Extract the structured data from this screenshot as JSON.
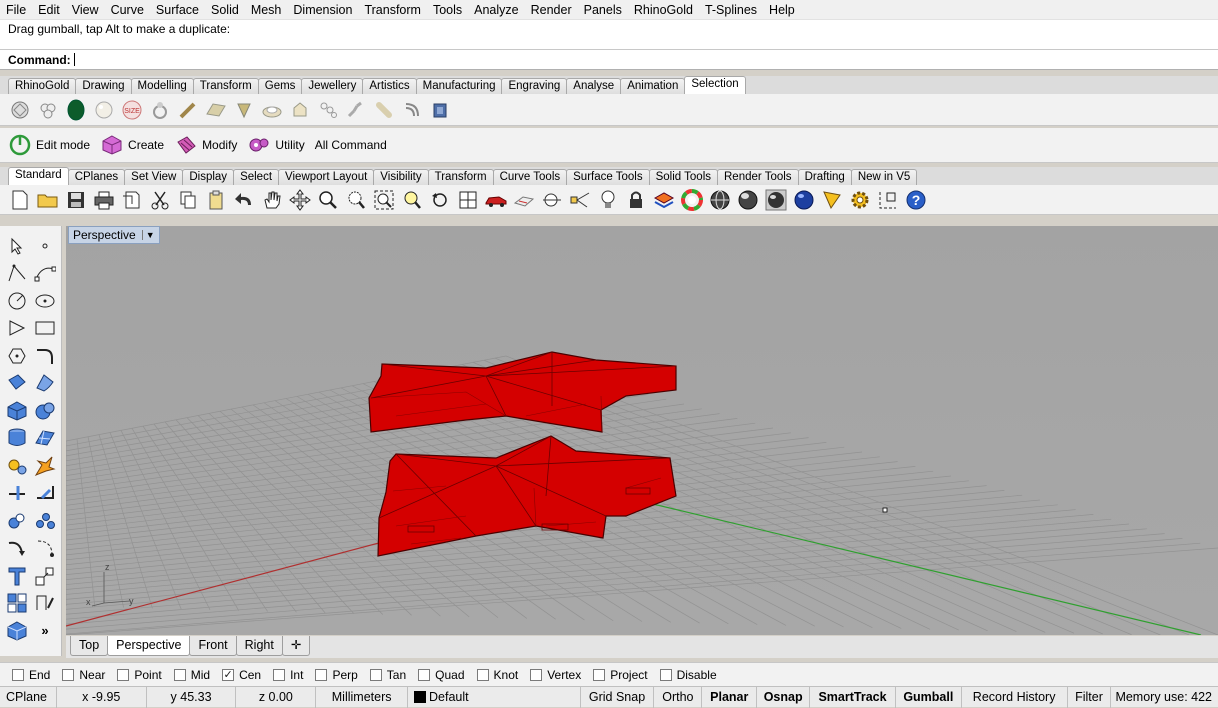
{
  "menu": [
    "File",
    "Edit",
    "View",
    "Curve",
    "Surface",
    "Solid",
    "Mesh",
    "Dimension",
    "Transform",
    "Tools",
    "Analyze",
    "Render",
    "Panels",
    "RhinoGold",
    "T-Splines",
    "Help"
  ],
  "command": {
    "history": "Drag gumball, tap Alt to make a duplicate:",
    "label": "Command:"
  },
  "top_tabs": [
    "RhinoGold",
    "Drawing",
    "Modelling",
    "Transform",
    "Gems",
    "Jewellery",
    "Artistics",
    "Manufacturing",
    "Engraving",
    "Analyse",
    "Animation",
    "Selection"
  ],
  "top_tabs_active": "Selection",
  "gem_toolbar_icons": [
    "diamond-gem-icon",
    "gem-cluster-icon",
    "emerald-gem-icon",
    "pearl-icon",
    "size-badge-icon",
    "ring-icon",
    "wire-tool-icon",
    "gold-bar-icon",
    "prong-icon",
    "bezel-icon",
    "setting-icon",
    "chain-icon",
    "pave-icon",
    "bracelet-icon",
    "clasp-icon",
    "box-icon"
  ],
  "edit_toolbar": {
    "edit_mode": "Edit mode",
    "create": "Create",
    "modify": "Modify",
    "utility": "Utility",
    "all_command": "All Command"
  },
  "std_tabs": [
    "Standard",
    "CPlanes",
    "Set View",
    "Display",
    "Select",
    "Viewport Layout",
    "Visibility",
    "Transform",
    "Curve Tools",
    "Surface Tools",
    "Solid Tools",
    "Render Tools",
    "Drafting",
    "New in V5"
  ],
  "std_tabs_active": "Standard",
  "viewport": {
    "name": "Perspective",
    "axis_labels": {
      "z": "z",
      "y": "y",
      "x": "x"
    }
  },
  "viewport_tabs": [
    "Top",
    "Perspective",
    "Front",
    "Right"
  ],
  "viewport_tabs_active": "Perspective",
  "osnaps": [
    {
      "label": "End",
      "checked": false
    },
    {
      "label": "Near",
      "checked": false
    },
    {
      "label": "Point",
      "checked": false
    },
    {
      "label": "Mid",
      "checked": false
    },
    {
      "label": "Cen",
      "checked": true
    },
    {
      "label": "Int",
      "checked": false
    },
    {
      "label": "Perp",
      "checked": false
    },
    {
      "label": "Tan",
      "checked": false
    },
    {
      "label": "Quad",
      "checked": false
    },
    {
      "label": "Knot",
      "checked": false
    },
    {
      "label": "Vertex",
      "checked": false
    },
    {
      "label": "Project",
      "checked": false
    },
    {
      "label": "Disable",
      "checked": false
    }
  ],
  "status": {
    "cplane": "CPlane",
    "x": "x -9.95",
    "y": "y 45.33",
    "z": "z 0.00",
    "units": "Millimeters",
    "layer": "Default",
    "grid_snap": "Grid Snap",
    "ortho": "Ortho",
    "planar": "Planar",
    "osnap": "Osnap",
    "smarttrack": "SmartTrack",
    "gumball": "Gumball",
    "record_history": "Record History",
    "filter": "Filter",
    "memory": "Memory use: 422"
  },
  "colors": {
    "object_red": "#d40000",
    "object_edge": "#5a0000",
    "viewport_bg": "#a5a5a5",
    "grid_line": "#8f8f8f",
    "x_axis": "#b03030",
    "y_axis": "#2fa02f",
    "layer_swatch": "#000000"
  }
}
